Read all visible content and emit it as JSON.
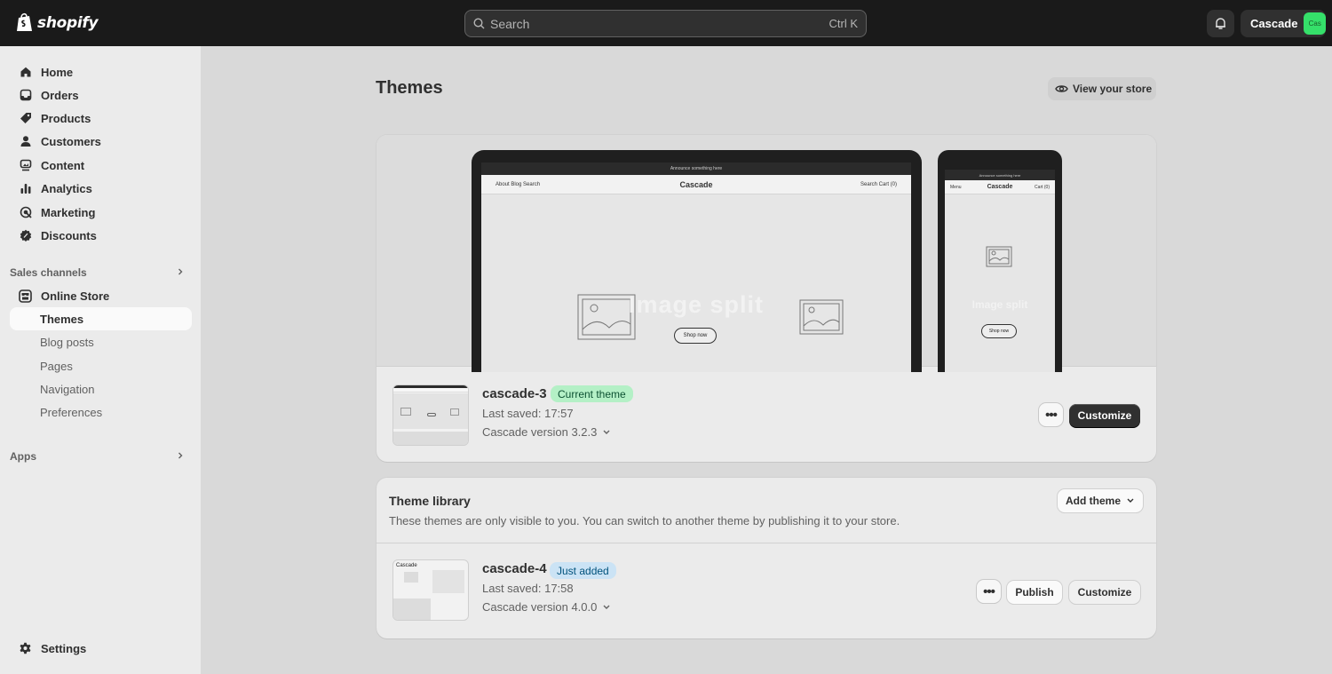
{
  "topbar": {
    "brand": "shopify",
    "search_placeholder": "Search",
    "search_shortcut": "Ctrl K",
    "store_name": "Cascade",
    "store_avatar": "Cas",
    "accent_green": "#35e06a"
  },
  "sidebar": {
    "items": [
      {
        "label": "Home",
        "icon": "home-icon"
      },
      {
        "label": "Orders",
        "icon": "inbox-icon"
      },
      {
        "label": "Products",
        "icon": "tag-icon"
      },
      {
        "label": "Customers",
        "icon": "person-icon"
      },
      {
        "label": "Content",
        "icon": "content-icon"
      },
      {
        "label": "Analytics",
        "icon": "bar-chart-icon"
      },
      {
        "label": "Marketing",
        "icon": "target-icon"
      },
      {
        "label": "Discounts",
        "icon": "discount-icon"
      }
    ],
    "sales_channels_label": "Sales channels",
    "online_store_label": "Online Store",
    "sub_items": [
      "Themes",
      "Blog posts",
      "Pages",
      "Navigation",
      "Preferences"
    ],
    "apps_label": "Apps",
    "settings_label": "Settings"
  },
  "main": {
    "title": "Themes",
    "view_store_label": "View your store",
    "preview": {
      "announcement": "Announce something here",
      "nav_left": "About  Blog  Search",
      "nav_brand": "Cascade",
      "nav_right": "Search   Cart (0)",
      "hero_text": "Image split",
      "cta": "Shop now",
      "phone_menu": "Menu",
      "phone_cart": "Cart (0)"
    },
    "current_theme": {
      "name": "cascade-3",
      "badge": "Current theme",
      "last_saved": "Last saved: 17:57",
      "version": "Cascade version 3.2.3",
      "more_label": "•••",
      "customize_label": "Customize"
    },
    "library": {
      "title": "Theme library",
      "description": "These themes are only visible to you. You can switch to another theme by publishing it to your store.",
      "add_theme_label": "Add theme",
      "theme": {
        "name": "cascade-4",
        "badge": "Just added",
        "last_saved": "Last saved: 17:58",
        "version": "Cascade version 4.0.0",
        "thumb_brand": "Cascade",
        "more_label": "•••",
        "publish_label": "Publish",
        "customize_label": "Customize"
      }
    }
  }
}
